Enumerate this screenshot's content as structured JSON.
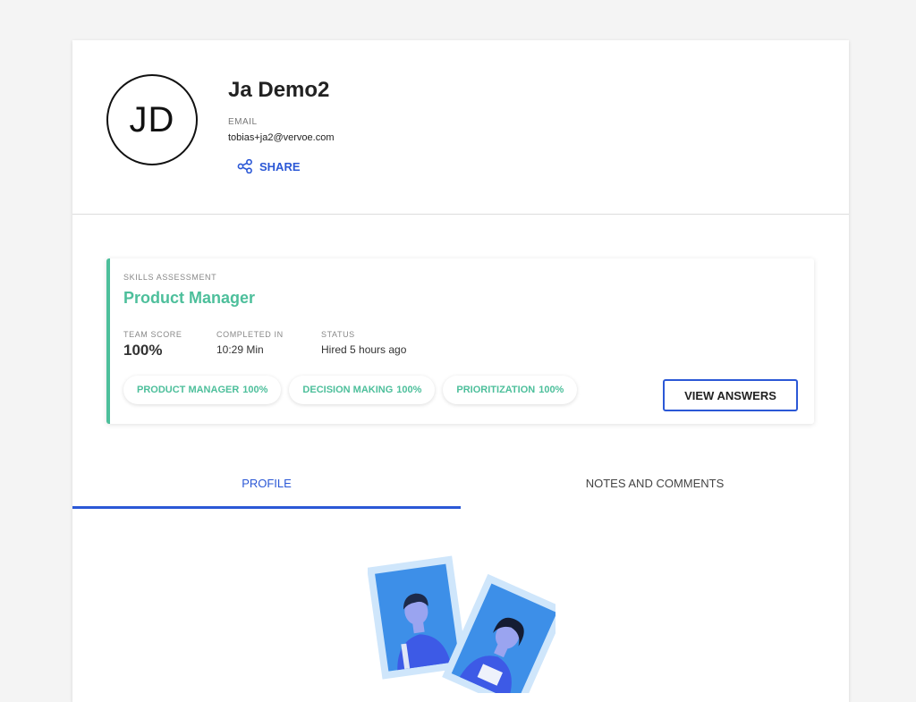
{
  "candidate": {
    "initials": "JD",
    "name": "Ja Demo2",
    "email_label": "EMAIL",
    "email": "tobias+ja2@vervoe.com",
    "share_label": "SHARE",
    "share_icon": "share-icon"
  },
  "assessment": {
    "type_label": "SKILLS ASSESSMENT",
    "title": "Product Manager",
    "stats": {
      "team_score_label": "TEAM SCORE",
      "team_score": "100%",
      "completed_label": "COMPLETED IN",
      "completed": "10:29 Min",
      "status_label": "STATUS",
      "status": "Hired 5 hours ago"
    },
    "skills": [
      {
        "name": "PRODUCT MANAGER",
        "score": "100%"
      },
      {
        "name": "DECISION MAKING",
        "score": "100%"
      },
      {
        "name": "PRIORITIZATION",
        "score": "100%"
      }
    ],
    "view_answers_label": "VIEW ANSWERS"
  },
  "tabs": [
    {
      "label": "PROFILE",
      "active": true
    },
    {
      "label": "NOTES AND COMMENTS",
      "active": false
    }
  ],
  "colors": {
    "accent_blue": "#2b58d6",
    "accent_green": "#4dbf9b"
  }
}
